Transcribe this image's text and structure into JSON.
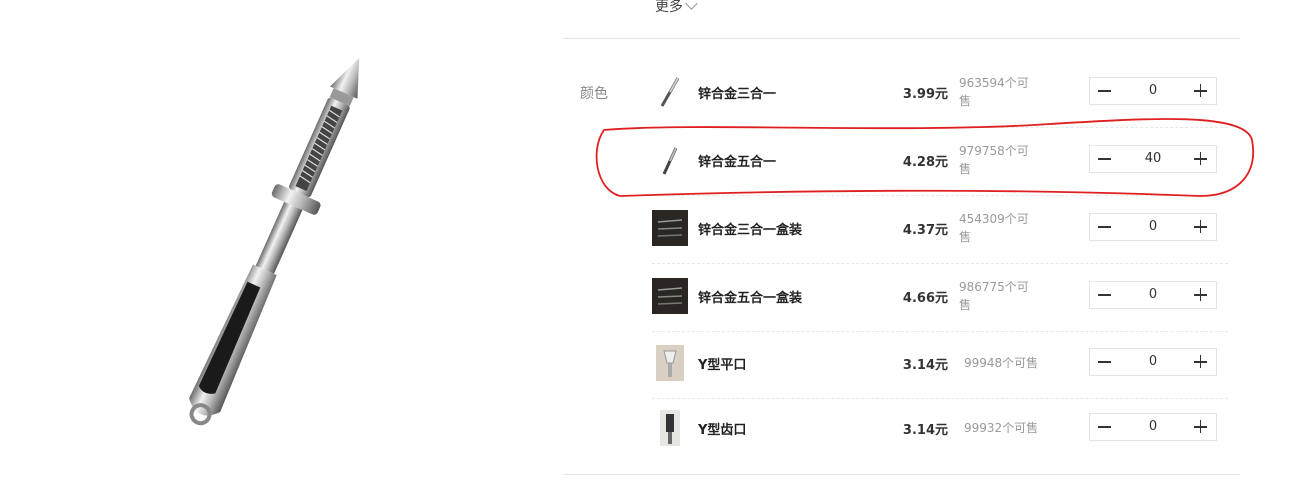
{
  "filter": {
    "more_label": "更多"
  },
  "color_label": "颜色",
  "variants": [
    {
      "name": "锌合金三合一",
      "price": "3.99元",
      "stock": "963594个可售",
      "qty": "0",
      "thumb": "peeler-thin"
    },
    {
      "name": "锌合金五合一",
      "price": "4.28元",
      "stock": "979758个可售",
      "qty": "40",
      "thumb": "peeler-thin"
    },
    {
      "name": "锌合金三合一盒装",
      "price": "4.37元",
      "stock": "454309个可售",
      "qty": "0",
      "thumb": "boxed-set"
    },
    {
      "name": "锌合金五合一盒装",
      "price": "4.66元",
      "stock": "986775个可售",
      "qty": "0",
      "thumb": "boxed-set"
    },
    {
      "name": "Y型平口",
      "price": "3.14元",
      "stock": "99948个可售",
      "qty": "0",
      "thumb": "y-peeler"
    },
    {
      "name": "Y型齿口",
      "price": "3.14元",
      "stock": "99932个可售",
      "qty": "0",
      "thumb": "y-peeler-serrated"
    }
  ],
  "annotation": {
    "color": "#e02020",
    "highlighted_variant": "锌合金五合一"
  },
  "colors": {
    "text": "#333333",
    "muted": "#999999",
    "border": "#e3e3e3"
  }
}
